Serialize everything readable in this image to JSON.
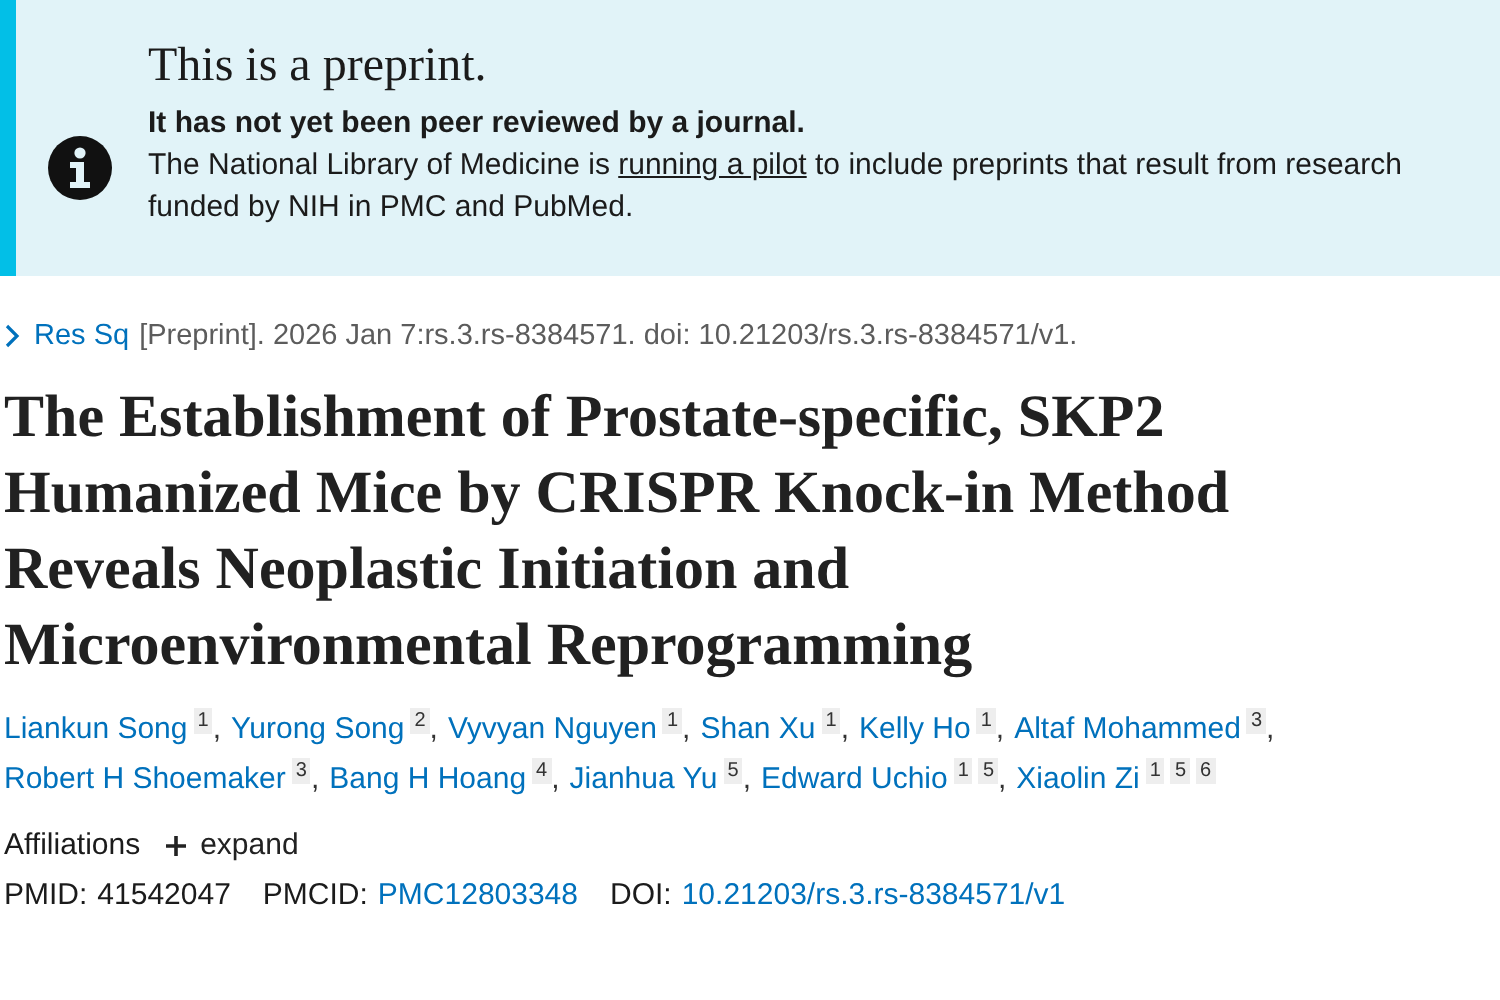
{
  "notice": {
    "title": "This is a preprint.",
    "subtitle": "It has not yet been peer reviewed by a journal.",
    "text_before": "The National Library of Medicine is",
    "link": "running a pilot",
    "text_after": "to include preprints that result from research funded by NIH in PMC and PubMed."
  },
  "citation": {
    "source": "Res Sq",
    "text": "[Preprint]. 2026 Jan 7:rs.3.rs-8384571. doi: 10.21203/rs.3.rs-8384571/v1."
  },
  "title": "The Establishment of Prostate-specific, SKP2 Humanized Mice by CRISPR Knock-in Method Reveals Neoplastic Initiation and Microenvironmental Reprogramming",
  "authors": [
    {
      "name": "Liankun Song",
      "affiliations": [
        "1"
      ],
      "separator": ","
    },
    {
      "name": "Yurong Song",
      "affiliations": [
        "2"
      ],
      "separator": ","
    },
    {
      "name": "Vyvyan Nguyen",
      "affiliations": [
        "1"
      ],
      "separator": ","
    },
    {
      "name": "Shan Xu",
      "affiliations": [
        "1"
      ],
      "separator": ","
    },
    {
      "name": "Kelly Ho",
      "affiliations": [
        "1"
      ],
      "separator": ","
    },
    {
      "name": "Altaf Mohammed",
      "affiliations": [
        "3"
      ],
      "separator": ","
    },
    {
      "name": "Robert H Shoemaker",
      "affiliations": [
        "3"
      ],
      "separator": ","
    },
    {
      "name": "Bang H Hoang",
      "affiliations": [
        "4"
      ],
      "separator": ","
    },
    {
      "name": "Jianhua Yu",
      "affiliations": [
        "5"
      ],
      "separator": ","
    },
    {
      "name": "Edward Uchio",
      "affiliations": [
        "1",
        "5"
      ],
      "separator": ","
    },
    {
      "name": "Xiaolin Zi",
      "affiliations": [
        "1",
        "5",
        "6"
      ]
    }
  ],
  "affiliations": {
    "label": "Affiliations",
    "toggle": "expand",
    "expanded": false
  },
  "ids": [
    {
      "label": "PMID:",
      "value": "41542047",
      "linked": false
    },
    {
      "label": "PMCID:",
      "value": "PMC12803348",
      "linked": true
    },
    {
      "label": "DOI:",
      "value": "10.21203/rs.3.rs-8384571/v1",
      "linked": true
    }
  ]
}
